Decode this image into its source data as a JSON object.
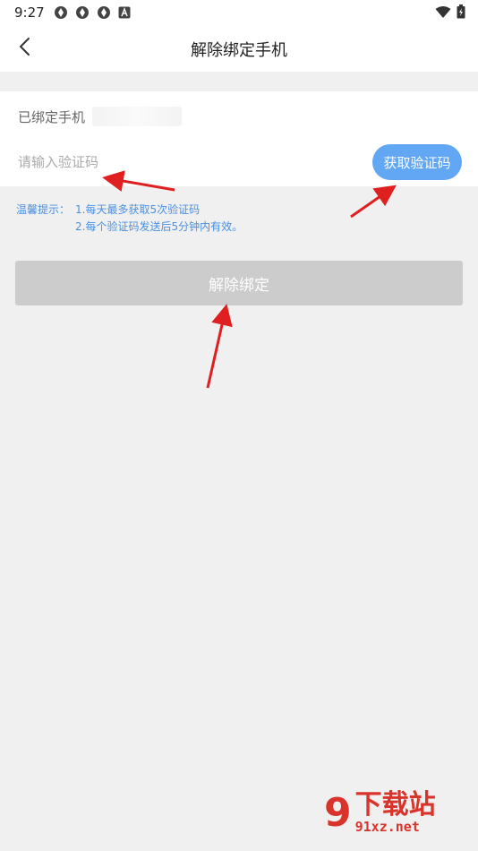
{
  "status_bar": {
    "time": "9:27",
    "notification_icons": [
      "app-icon",
      "app-icon",
      "app-icon",
      "font-icon"
    ],
    "right_icons": [
      "wifi-icon",
      "battery-icon"
    ]
  },
  "header": {
    "back_icon": "chevron-left-icon",
    "title": "解除绑定手机"
  },
  "form": {
    "bound_label": "已绑定手机",
    "bound_value": "",
    "code_placeholder": "请输入验证码",
    "get_code_label": "获取验证码"
  },
  "tips": {
    "prefix": "温馨提示：",
    "line1": "1.每天最多获取5次验证码",
    "line2": "2.每个验证码发送后5分钟内有效。"
  },
  "unbind_button": {
    "label": "解除绑定"
  },
  "watermark": {
    "logo": "9",
    "title": "下载站",
    "domain": "91xz.net"
  },
  "colors": {
    "accent": "#62a7f3",
    "tip_text": "#4a90e2",
    "disabled_button": "#cccccc",
    "annotation_arrow": "#e02020"
  }
}
